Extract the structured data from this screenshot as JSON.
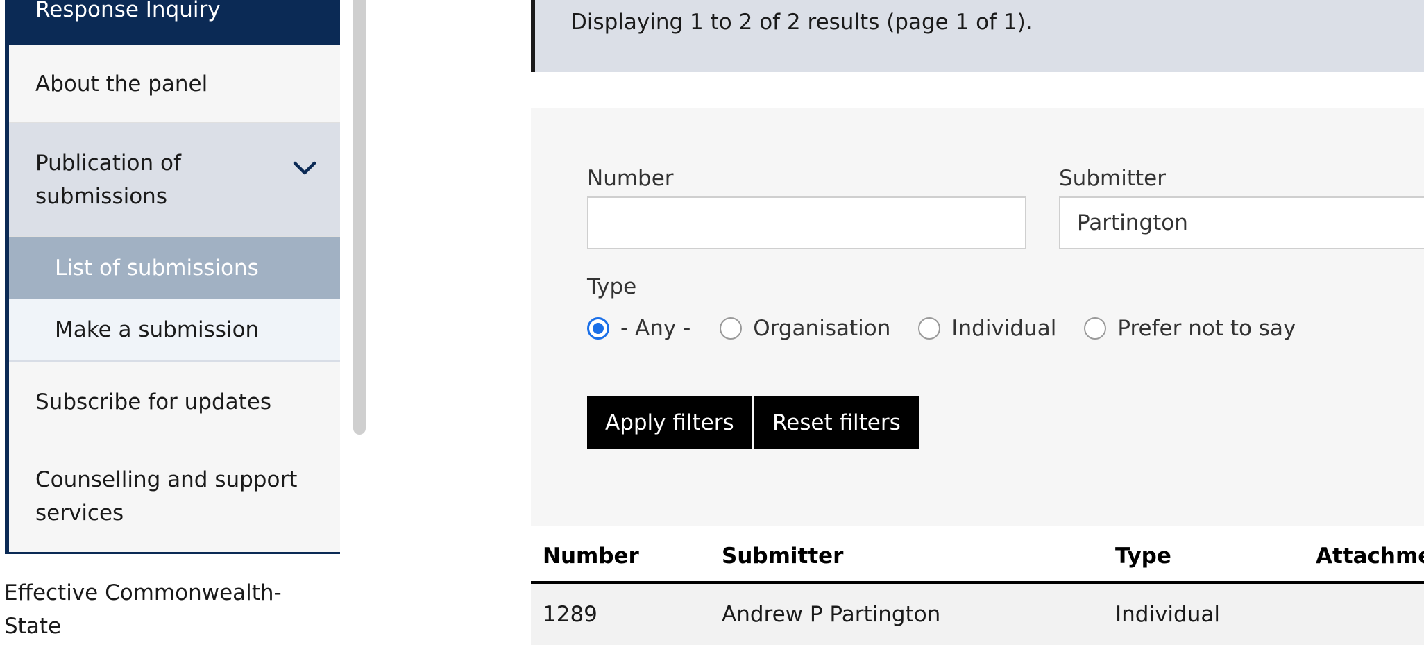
{
  "sidebar": {
    "items": [
      {
        "label": "Response Inquiry"
      },
      {
        "label": "About the panel"
      },
      {
        "label": "Publication of submissions"
      },
      {
        "label": "List of submissions"
      },
      {
        "label": "Make a submission"
      },
      {
        "label": "Subscribe for updates"
      },
      {
        "label": "Counselling and support services"
      }
    ],
    "expand_icon": "chevron-down-icon"
  },
  "footer_text": "Effective Commonwealth-State",
  "results_summary": "Displaying 1 to 2 of 2 results (page 1 of 1).",
  "filters": {
    "number_label": "Number",
    "number_value": "",
    "submitter_label": "Submitter",
    "submitter_value": "Partington",
    "type_label": "Type",
    "type_options": [
      "- Any -",
      "Organisation",
      "Individual",
      "Prefer not to say"
    ],
    "type_selected": "- Any -",
    "apply_label": "Apply filters",
    "reset_label": "Reset filters"
  },
  "table": {
    "headers": [
      "Number",
      "Submitter",
      "Type",
      "Attachme"
    ],
    "rows": [
      {
        "number": "1289",
        "submitter": "Andrew P Partington",
        "type": "Individual"
      }
    ]
  },
  "colors": {
    "navy": "#0b2a55",
    "active_item": "#a1b1c3",
    "expanded_item": "#dbdfe7",
    "radio_accent": "#1a6fe8",
    "button": "#000000"
  }
}
